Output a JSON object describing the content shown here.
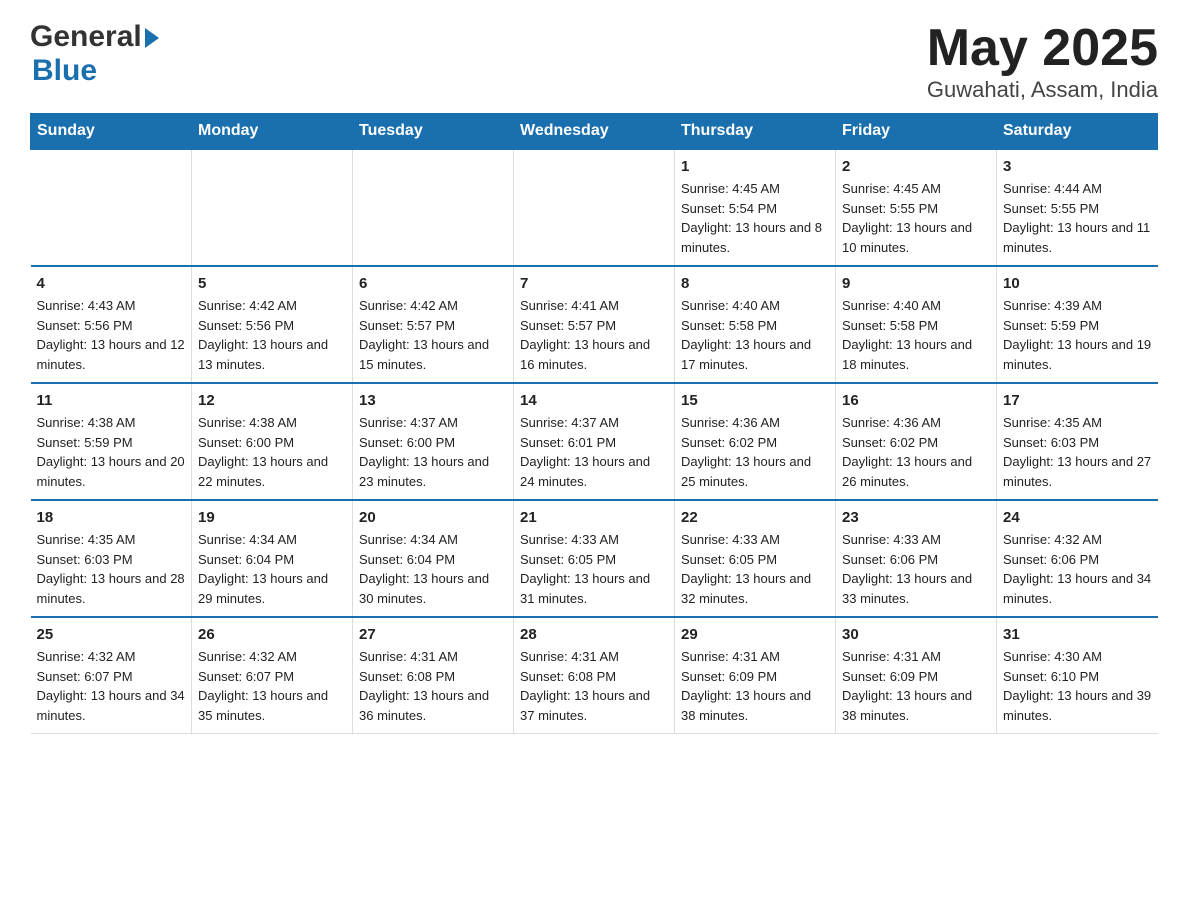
{
  "header": {
    "logo_general": "General",
    "logo_blue": "Blue",
    "title": "May 2025",
    "subtitle": "Guwahati, Assam, India"
  },
  "days_of_week": [
    "Sunday",
    "Monday",
    "Tuesday",
    "Wednesday",
    "Thursday",
    "Friday",
    "Saturday"
  ],
  "weeks": [
    [
      {
        "day": "",
        "sunrise": "",
        "sunset": "",
        "daylight": ""
      },
      {
        "day": "",
        "sunrise": "",
        "sunset": "",
        "daylight": ""
      },
      {
        "day": "",
        "sunrise": "",
        "sunset": "",
        "daylight": ""
      },
      {
        "day": "",
        "sunrise": "",
        "sunset": "",
        "daylight": ""
      },
      {
        "day": "1",
        "sunrise": "Sunrise: 4:45 AM",
        "sunset": "Sunset: 5:54 PM",
        "daylight": "Daylight: 13 hours and 8 minutes."
      },
      {
        "day": "2",
        "sunrise": "Sunrise: 4:45 AM",
        "sunset": "Sunset: 5:55 PM",
        "daylight": "Daylight: 13 hours and 10 minutes."
      },
      {
        "day": "3",
        "sunrise": "Sunrise: 4:44 AM",
        "sunset": "Sunset: 5:55 PM",
        "daylight": "Daylight: 13 hours and 11 minutes."
      }
    ],
    [
      {
        "day": "4",
        "sunrise": "Sunrise: 4:43 AM",
        "sunset": "Sunset: 5:56 PM",
        "daylight": "Daylight: 13 hours and 12 minutes."
      },
      {
        "day": "5",
        "sunrise": "Sunrise: 4:42 AM",
        "sunset": "Sunset: 5:56 PM",
        "daylight": "Daylight: 13 hours and 13 minutes."
      },
      {
        "day": "6",
        "sunrise": "Sunrise: 4:42 AM",
        "sunset": "Sunset: 5:57 PM",
        "daylight": "Daylight: 13 hours and 15 minutes."
      },
      {
        "day": "7",
        "sunrise": "Sunrise: 4:41 AM",
        "sunset": "Sunset: 5:57 PM",
        "daylight": "Daylight: 13 hours and 16 minutes."
      },
      {
        "day": "8",
        "sunrise": "Sunrise: 4:40 AM",
        "sunset": "Sunset: 5:58 PM",
        "daylight": "Daylight: 13 hours and 17 minutes."
      },
      {
        "day": "9",
        "sunrise": "Sunrise: 4:40 AM",
        "sunset": "Sunset: 5:58 PM",
        "daylight": "Daylight: 13 hours and 18 minutes."
      },
      {
        "day": "10",
        "sunrise": "Sunrise: 4:39 AM",
        "sunset": "Sunset: 5:59 PM",
        "daylight": "Daylight: 13 hours and 19 minutes."
      }
    ],
    [
      {
        "day": "11",
        "sunrise": "Sunrise: 4:38 AM",
        "sunset": "Sunset: 5:59 PM",
        "daylight": "Daylight: 13 hours and 20 minutes."
      },
      {
        "day": "12",
        "sunrise": "Sunrise: 4:38 AM",
        "sunset": "Sunset: 6:00 PM",
        "daylight": "Daylight: 13 hours and 22 minutes."
      },
      {
        "day": "13",
        "sunrise": "Sunrise: 4:37 AM",
        "sunset": "Sunset: 6:00 PM",
        "daylight": "Daylight: 13 hours and 23 minutes."
      },
      {
        "day": "14",
        "sunrise": "Sunrise: 4:37 AM",
        "sunset": "Sunset: 6:01 PM",
        "daylight": "Daylight: 13 hours and 24 minutes."
      },
      {
        "day": "15",
        "sunrise": "Sunrise: 4:36 AM",
        "sunset": "Sunset: 6:02 PM",
        "daylight": "Daylight: 13 hours and 25 minutes."
      },
      {
        "day": "16",
        "sunrise": "Sunrise: 4:36 AM",
        "sunset": "Sunset: 6:02 PM",
        "daylight": "Daylight: 13 hours and 26 minutes."
      },
      {
        "day": "17",
        "sunrise": "Sunrise: 4:35 AM",
        "sunset": "Sunset: 6:03 PM",
        "daylight": "Daylight: 13 hours and 27 minutes."
      }
    ],
    [
      {
        "day": "18",
        "sunrise": "Sunrise: 4:35 AM",
        "sunset": "Sunset: 6:03 PM",
        "daylight": "Daylight: 13 hours and 28 minutes."
      },
      {
        "day": "19",
        "sunrise": "Sunrise: 4:34 AM",
        "sunset": "Sunset: 6:04 PM",
        "daylight": "Daylight: 13 hours and 29 minutes."
      },
      {
        "day": "20",
        "sunrise": "Sunrise: 4:34 AM",
        "sunset": "Sunset: 6:04 PM",
        "daylight": "Daylight: 13 hours and 30 minutes."
      },
      {
        "day": "21",
        "sunrise": "Sunrise: 4:33 AM",
        "sunset": "Sunset: 6:05 PM",
        "daylight": "Daylight: 13 hours and 31 minutes."
      },
      {
        "day": "22",
        "sunrise": "Sunrise: 4:33 AM",
        "sunset": "Sunset: 6:05 PM",
        "daylight": "Daylight: 13 hours and 32 minutes."
      },
      {
        "day": "23",
        "sunrise": "Sunrise: 4:33 AM",
        "sunset": "Sunset: 6:06 PM",
        "daylight": "Daylight: 13 hours and 33 minutes."
      },
      {
        "day": "24",
        "sunrise": "Sunrise: 4:32 AM",
        "sunset": "Sunset: 6:06 PM",
        "daylight": "Daylight: 13 hours and 34 minutes."
      }
    ],
    [
      {
        "day": "25",
        "sunrise": "Sunrise: 4:32 AM",
        "sunset": "Sunset: 6:07 PM",
        "daylight": "Daylight: 13 hours and 34 minutes."
      },
      {
        "day": "26",
        "sunrise": "Sunrise: 4:32 AM",
        "sunset": "Sunset: 6:07 PM",
        "daylight": "Daylight: 13 hours and 35 minutes."
      },
      {
        "day": "27",
        "sunrise": "Sunrise: 4:31 AM",
        "sunset": "Sunset: 6:08 PM",
        "daylight": "Daylight: 13 hours and 36 minutes."
      },
      {
        "day": "28",
        "sunrise": "Sunrise: 4:31 AM",
        "sunset": "Sunset: 6:08 PM",
        "daylight": "Daylight: 13 hours and 37 minutes."
      },
      {
        "day": "29",
        "sunrise": "Sunrise: 4:31 AM",
        "sunset": "Sunset: 6:09 PM",
        "daylight": "Daylight: 13 hours and 38 minutes."
      },
      {
        "day": "30",
        "sunrise": "Sunrise: 4:31 AM",
        "sunset": "Sunset: 6:09 PM",
        "daylight": "Daylight: 13 hours and 38 minutes."
      },
      {
        "day": "31",
        "sunrise": "Sunrise: 4:30 AM",
        "sunset": "Sunset: 6:10 PM",
        "daylight": "Daylight: 13 hours and 39 minutes."
      }
    ]
  ]
}
